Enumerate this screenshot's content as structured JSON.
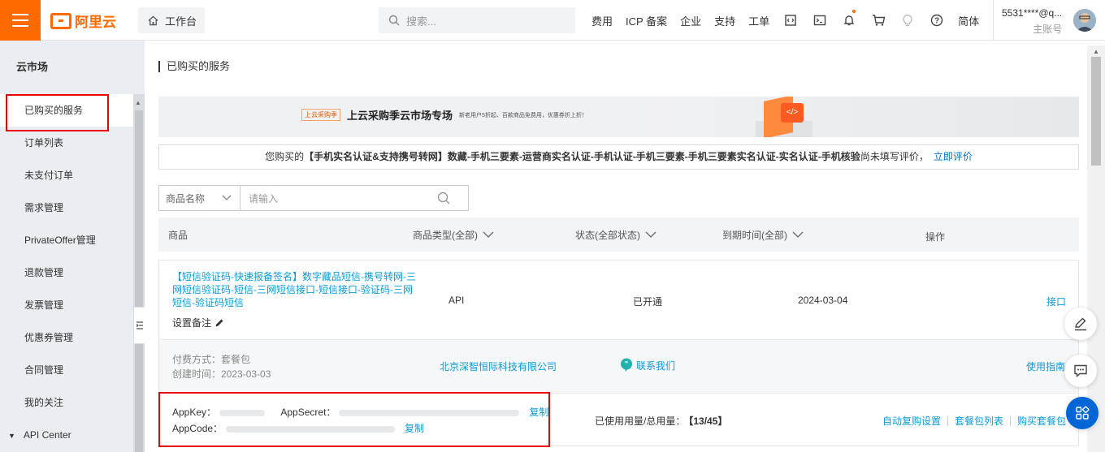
{
  "topbar": {
    "logo_text": "阿里云",
    "workbench": "工作台",
    "search_placeholder": "搜索...",
    "links": [
      "费用",
      "ICP 备案",
      "企业",
      "支持",
      "工单"
    ],
    "lang": "简体",
    "account_name": "5531****@q...",
    "account_role": "主账号",
    "brand_color": "#ff6a00"
  },
  "sidebar": {
    "title": "云市场",
    "items": [
      "已购买的服务",
      "订单列表",
      "未支付订单",
      "需求管理",
      "PrivateOffer管理",
      "退款管理",
      "发票管理",
      "优惠券管理",
      "合同管理",
      "我的关注"
    ],
    "api_center": "API Center"
  },
  "main": {
    "title": "已购买的服务",
    "banner": {
      "tag": "上云采购季",
      "headline": "上云采购季云市场专场",
      "subline": "新老用户5折起、百款商品免费用，优惠券折上折！"
    },
    "notice": {
      "prefix": "您购买的",
      "product": "【手机实名认证&支持携号转网】数藏-手机三要素-运营商实名认证-手机认证-手机三要素-手机三要素实名认证-实名认证-手机核验",
      "suffix": "尚未填写评价，",
      "link": "立即评价"
    },
    "filter": {
      "select": "商品名称",
      "placeholder": "请输入"
    },
    "table_headers": {
      "product": "商品",
      "type": "商品类型(全部)",
      "status": "状态(全部状态)",
      "expiry": "到期时间(全部)",
      "action": "操作"
    },
    "order": {
      "product_name": "【短信验证码-快速报备签名】数字藏品短信-携号转网-三网短信验证码-短信-三网短信接口-短信接口-验证码-三网短信-验证码短信",
      "memo": "设置备注",
      "type": "API",
      "status": "已开通",
      "expiry": "2024-03-04",
      "action": "接口",
      "payment": "付费方式：套餐包",
      "created": "创建时间：2023-03-03",
      "vendor": "北京深智恒际科技有限公司",
      "contact": "联系我们",
      "guide": "使用指南",
      "appkey_label": "AppKey：",
      "appsecret_label": "AppSecret：",
      "appcode_label": "AppCode：",
      "copy": "复制",
      "usage_label": "已使用用量/总用量：",
      "usage_value": "【13/45】",
      "actions": [
        "自动复购设置",
        "套餐包列表",
        "购买套餐包"
      ]
    }
  }
}
